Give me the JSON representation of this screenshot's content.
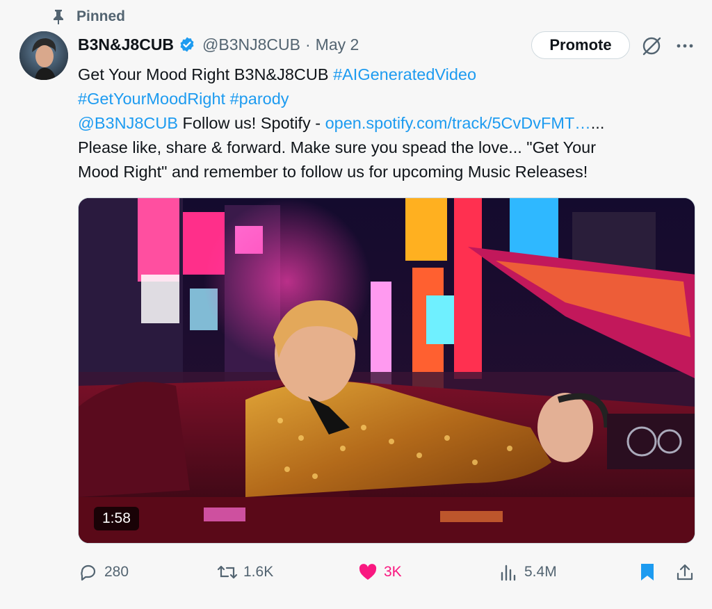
{
  "pinned": {
    "label": "Pinned",
    "icon": "pin-icon"
  },
  "author": {
    "display_name": "B3N&J8CUB",
    "handle": "@B3NJ8CUB",
    "separator": "·",
    "date": "May 2",
    "verified_color": "#1d9bf0"
  },
  "header_actions": {
    "promote_label": "Promote",
    "grok_icon": "grok-icon",
    "more_icon": "more-horizontal-icon"
  },
  "tweet": {
    "line1_text": "Get Your Mood Right  B3N&J8CUB ",
    "line1_hashtag": "#AIGeneratedVideo",
    "line2_hashtag1": "#GetYourMoodRight",
    "line2_hashtag2": "#parody",
    "line3_mention": "@B3NJ8CUB",
    "line3_text": " Follow us! Spotify - ",
    "line3_link": "open.spotify.com/track/5CvDvFMT…",
    "line3_trailing": "...",
    "line4": "Please like, share & forward. Make sure you spead the love... \"Get Your",
    "line5": "Mood Right\" and remember to follow us for upcoming Music Releases!"
  },
  "media": {
    "duration": "1:58"
  },
  "actions": {
    "replies": "280",
    "reposts": "1.6K",
    "likes": "3K",
    "views": "5.4M",
    "like_color": "#f91880",
    "bookmark_color": "#1d9bf0"
  }
}
